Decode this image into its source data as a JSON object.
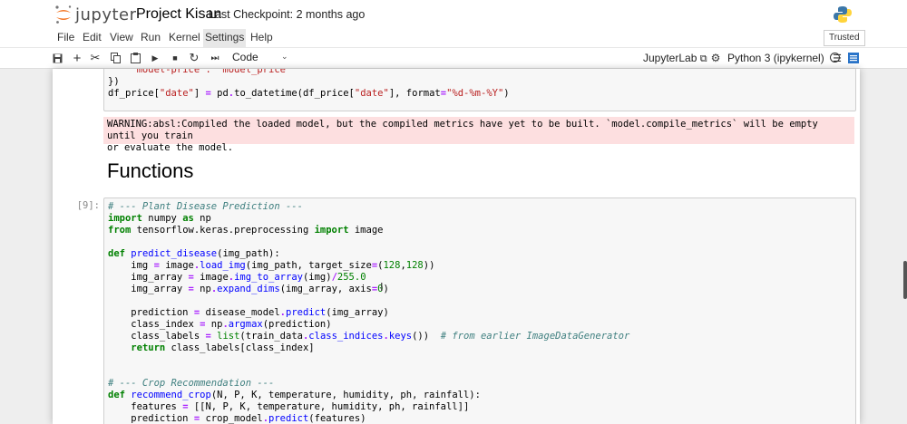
{
  "app": {
    "logo_text": "jupyter",
    "notebook_name": "Project Kisan",
    "checkpoint": "Last Checkpoint: 2 months ago",
    "trusted": "Trusted"
  },
  "menu": [
    "File",
    "Edit",
    "View",
    "Run",
    "Kernel",
    "Settings",
    "Help"
  ],
  "toolbar": {
    "cell_type": "Code",
    "jupyterlab_label": "JupyterLab",
    "kernel_name": "Python 3 (ipykernel)"
  },
  "icons": [
    "save-icon",
    "add-icon",
    "cut-icon",
    "copy-icon",
    "paste-icon",
    "run-icon",
    "stop-icon",
    "restart-icon",
    "fast-forward-icon",
    "external-link-icon",
    "gear-icon",
    "kernel-idle-icon",
    "bug-icon",
    "list-icon"
  ],
  "cells": {
    "top_code_partial": "    \"model-price\": \"model_price\"",
    "top_code_line2": "})",
    "warning_line1": "WARNING:absl:Compiled the loaded model, but the compiled metrics have yet to be built. `model.compile_metrics` will be empty until you train",
    "warning_line2": "or evaluate the model.",
    "heading": "Functions",
    "prompt": "[9]:"
  },
  "colors": {
    "warning_bg": "#fddfe0",
    "code_bg": "#f7f7f7",
    "page_bg": "#eeeeee",
    "active_menu": "#e7e7e7"
  }
}
